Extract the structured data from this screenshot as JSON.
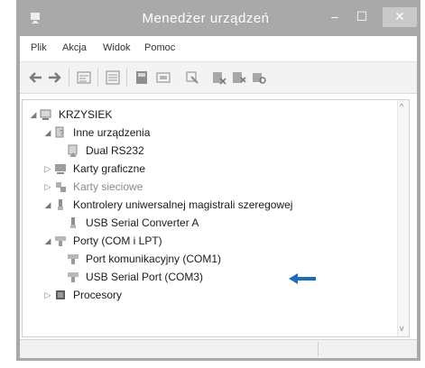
{
  "window": {
    "title": "Menedżer urządzeń",
    "buttons": {
      "minimize": "–",
      "maximize": "☐",
      "close": "✕"
    }
  },
  "menu": [
    "Plik",
    "Akcja",
    "Widok",
    "Pomoc"
  ],
  "toolbar_icons": [
    "back-arrow-icon",
    "forward-arrow-icon",
    "properties-icon",
    "scan-icon",
    "update-driver-icon",
    "display-icon",
    "device-icon",
    "disable-icon",
    "uninstall-icon",
    "scan-hardware-icon"
  ],
  "tree": [
    {
      "label": "KRZYSIEK",
      "icon": "computer-icon",
      "expanded": true
    },
    {
      "label": "Inne urządzenia",
      "icon": "unknown-device-icon",
      "expanded": true
    },
    {
      "label": "Dual RS232",
      "icon": "warning-device-icon"
    },
    {
      "label": "Karty graficzne",
      "icon": "display-adapter-icon",
      "expanded": false
    },
    {
      "label": "Karty sieciowe",
      "icon": "network-adapter-icon",
      "expanded": false
    },
    {
      "label": "Kontrolery uniwersalnej magistrali szeregowej",
      "icon": "usb-controller-icon",
      "expanded": true
    },
    {
      "label": "USB Serial Converter A",
      "icon": "usb-device-icon"
    },
    {
      "label": "Porty (COM i LPT)",
      "icon": "port-icon",
      "expanded": true
    },
    {
      "label": "Port komunikacyjny (COM1)",
      "icon": "port-icon"
    },
    {
      "label": "USB Serial Port (COM3)",
      "icon": "port-icon"
    },
    {
      "label": "Procesory",
      "icon": "processor-icon",
      "expanded": false
    }
  ],
  "colors": {
    "titlebar": "#a9a9a9",
    "arrow": "#1e6bb8"
  }
}
